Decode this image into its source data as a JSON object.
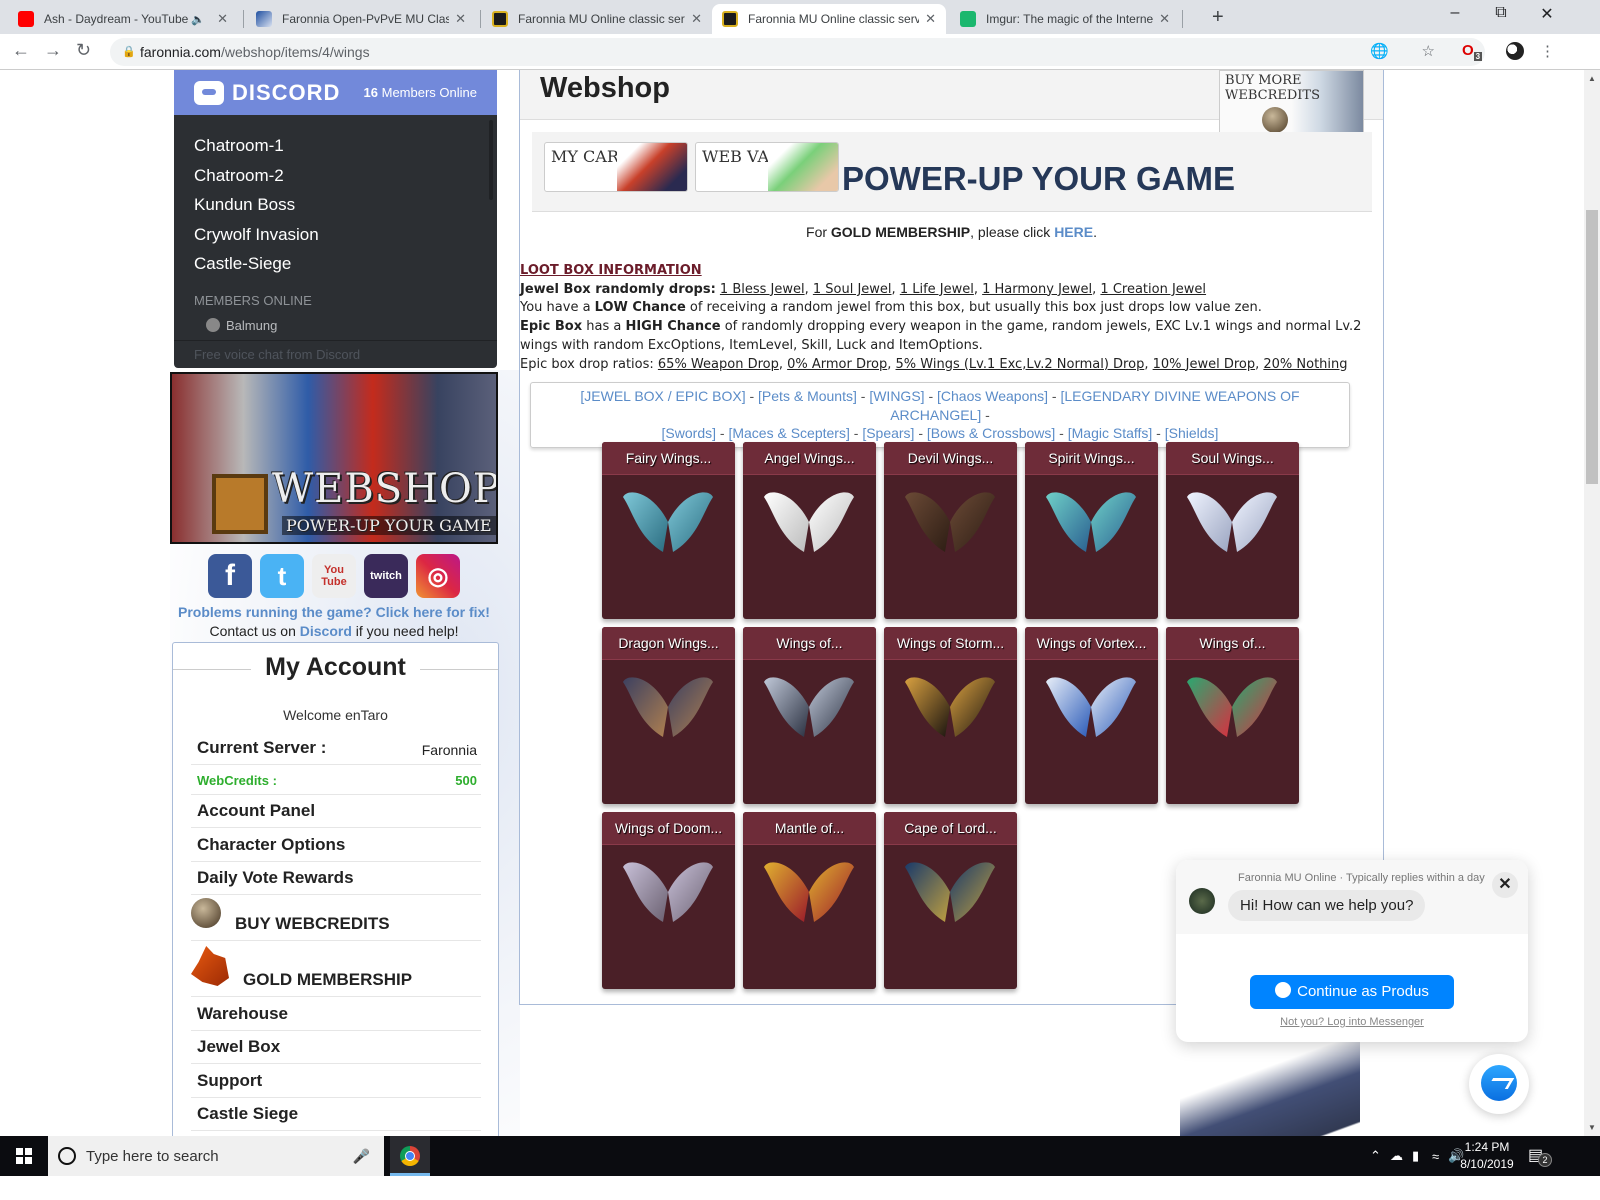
{
  "browser": {
    "tabs": [
      {
        "title": "Ash - Daydream - YouTube",
        "favicon": "youtube-icon",
        "audio": true,
        "active": false
      },
      {
        "title": "Faronnia Open-PvPvE MU Classic",
        "favicon": "faronnia-icon",
        "active": false
      },
      {
        "title": "Faronnia MU Online classic server",
        "favicon": "mu-icon",
        "active": false
      },
      {
        "title": "Faronnia MU Online classic server",
        "favicon": "mu-icon",
        "active": true
      },
      {
        "title": "Imgur: The magic of the Internet",
        "favicon": "imgur-icon",
        "active": false
      }
    ],
    "url_host": "faronnia.com",
    "url_path": "/webshop/items/4/wings",
    "extension_badge": "3"
  },
  "discord": {
    "brand": "DISCORD",
    "online_count": "16",
    "online_label": "Members Online",
    "channels": [
      "Chatroom-1",
      "Chatroom-2",
      "Kundun Boss",
      "Crywolf Invasion",
      "Castle-Siege"
    ],
    "members_header": "MEMBERS ONLINE",
    "members": [
      "Balmung"
    ],
    "footer": "Free voice chat from Discord"
  },
  "banner": {
    "title": "WEBSHOP",
    "subtitle": "POWER-UP YOUR GAME"
  },
  "social": {
    "icons": [
      "facebook-icon",
      "twitter-icon",
      "youtube-icon",
      "twitch-icon",
      "instagram-icon"
    ],
    "youtube_text": "You Tube",
    "twitch_text": "twitch"
  },
  "help": {
    "problems": "Problems running the game? Click here for fix!",
    "contact_pre": "Contact us on ",
    "contact_link": "Discord",
    "contact_post": " if you need help!"
  },
  "account": {
    "title": "My Account",
    "welcome": "Welcome enTaro",
    "server_label": "Current Server :",
    "server_value": "Faronnia",
    "credits_label": "WebCredits :",
    "credits_value": "500",
    "links": [
      "Account Panel",
      "Character Options",
      "Daily Vote Rewards",
      "BUY WEBCREDITS",
      "GOLD MEMBERSHIP",
      "Warehouse",
      "Jewel Box",
      "Support",
      "Castle Siege"
    ]
  },
  "main": {
    "title": "Webshop",
    "buy_more": "BUY MORE WEBCREDITS",
    "my_cart": "MY CART",
    "web_vault": "WEB VAULT",
    "power_up": "POWER-UP YOUR GAME",
    "gold": {
      "pre": "For ",
      "bold": "GOLD MEMBERSHIP",
      "mid": ", please click ",
      "link": "HERE",
      "post": "."
    }
  },
  "loot": {
    "title": "LOOT BOX INFORMATION",
    "jewel_label": "Jewel Box randomly drops:",
    "jewel_drops": [
      "1 Bless Jewel",
      "1 Soul Jewel",
      "1 Life Jewel",
      "1 Harmony Jewel",
      "1 Creation Jewel"
    ],
    "low_pre": "You have a ",
    "low_bold": "LOW Chance",
    "low_post": " of receiving a random jewel from this box, but usually this box just drops low value zen.",
    "epic_bold": "Epic Box",
    "epic_mid": " has a ",
    "epic_high": "HIGH Chance",
    "epic_post": " of randomly dropping every weapon in the game, random jewels, EXC Lv.1 wings and normal Lv.2 wings with random ExcOptions, ItemLevel, Skill, Luck and ItemOptions.",
    "ratios_label": "Epic box drop ratios:",
    "ratios": [
      "65% Weapon Drop",
      "0% Armor Drop",
      "5% Wings (Lv.1 Exc,Lv.2 Normal) Drop",
      "10% Jewel Drop",
      "20% Nothing"
    ]
  },
  "categories": [
    "[JEWEL BOX / EPIC BOX]",
    "[Pets & Mounts]",
    "[WINGS]",
    "[Chaos Weapons]",
    "[LEGENDARY DIVINE WEAPONS OF ARCHANGEL]",
    "[Swords]",
    "[Maces & Scepters]",
    "[Spears]",
    "[Bows & Crossbows]",
    "[Magic Staffs]",
    "[Shields]"
  ],
  "items": [
    {
      "name": "Fairy Wings...",
      "c1": "#7fc8d8",
      "c2": "#2a6c80"
    },
    {
      "name": "Angel Wings...",
      "c1": "#ffffff",
      "c2": "#bbbbbb"
    },
    {
      "name": "Devil Wings...",
      "c1": "#6b4a36",
      "c2": "#2d1d14"
    },
    {
      "name": "Spirit Wings...",
      "c1": "#6fd0c8",
      "c2": "#2a5f90"
    },
    {
      "name": "Soul Wings...",
      "c1": "#f0f4ff",
      "c2": "#9aa4c0"
    },
    {
      "name": "Dragon Wings...",
      "c1": "#3c4060",
      "c2": "#b08050"
    },
    {
      "name": "Wings of...",
      "c1": "#c0c8d8",
      "c2": "#2a3040"
    },
    {
      "name": "Wings of Storm...",
      "c1": "#d8a040",
      "c2": "#1a1410"
    },
    {
      "name": "Wings of Vortex...",
      "c1": "#e8eef8",
      "c2": "#2a5ab8"
    },
    {
      "name": "Wings of...",
      "c1": "#2aa870",
      "c2": "#d83040"
    },
    {
      "name": "Wings of Doom...",
      "c1": "#c8c0d8",
      "c2": "#6a6070"
    },
    {
      "name": "Mantle of...",
      "c1": "#e0b030",
      "c2": "#9a1a2a"
    },
    {
      "name": "Cape of Lord...",
      "c1": "#1a3a6a",
      "c2": "#c0a040"
    }
  ],
  "messenger": {
    "meta": "Faronnia MU Online · Typically replies within a day",
    "greeting": "Hi! How can we help you?",
    "button": "Continue as Produs",
    "login_link": "Not you? Log into Messenger"
  },
  "taskbar": {
    "search_placeholder": "Type here to search",
    "time": "1:24 PM",
    "date": "8/10/2019",
    "notifications": "2"
  }
}
